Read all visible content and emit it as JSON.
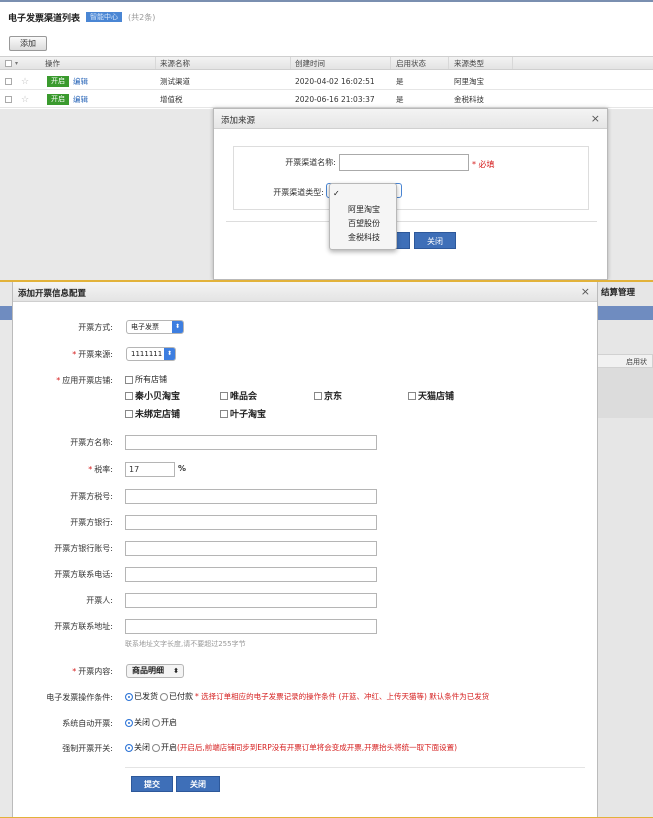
{
  "top_page": {
    "title": "电子发票渠道列表",
    "title_badge": "智能中心",
    "count": "(共2条)",
    "add_button": "添加",
    "columns": [
      "操作",
      "来源名称",
      "创建时间",
      "启用状态",
      "来源类型"
    ],
    "rows": [
      {
        "open": "开启",
        "edit": "编辑",
        "name": "测试渠道",
        "created": "2020-04-02 16:02:51",
        "enabled": "是",
        "type": "阿里淘宝"
      },
      {
        "open": "开启",
        "edit": "编辑",
        "name": "增值税",
        "created": "2020-06-16 21:03:37",
        "enabled": "是",
        "type": "金税科技"
      }
    ]
  },
  "source_dialog": {
    "title": "添加来源",
    "close_icon": "close-icon",
    "name_label": "开票渠道名称:",
    "name_value": "",
    "required_text": "* 必填",
    "type_label": "开票渠道类型:",
    "type_options": [
      "阿里淘宝",
      "百望股份",
      "金税科技"
    ],
    "close_button": "关闭"
  },
  "config_dialog": {
    "title": "添加开票信息配置",
    "close_icon": "close-icon",
    "method_label": "开票方式:",
    "method_value": "电子发票",
    "source_label": "开票来源:",
    "source_value": "1111111",
    "shops_label": "应用开票店铺:",
    "all_shops": "所有店铺",
    "shops_row1": [
      "秦小贝淘宝",
      "唯品会",
      "京东",
      "天猫店铺"
    ],
    "shops_row2": [
      "未绑定店铺",
      "叶子淘宝"
    ],
    "name_label": "开票方名称:",
    "rate_label": "税率:",
    "rate_value": "17",
    "rate_unit": "%",
    "taxno_label": "开票方税号:",
    "bank_label": "开票方银行:",
    "account_label": "开票方银行账号:",
    "phone_label": "开票方联系电话:",
    "drawer_label": "开票人:",
    "address_label": "开票方联系地址:",
    "address_hint": "联系地址文字长度,请不要超过255字节",
    "content_label": "开票内容:",
    "content_value": "商品明细",
    "condition_label": "电子发票操作条件:",
    "condition_paid": "已发货",
    "condition_paid2": "已付款",
    "condition_note": "* 选择订单相应的电子发票记录的操作条件 (开篮、冲红、上传天猫等) 默认条件为已发货",
    "auto_label": "系统自动开票:",
    "auto_off": "关闭",
    "auto_on": "开启",
    "force_label": "强制开票开关:",
    "force_off": "关闭",
    "force_on": "开启",
    "force_note": "(开启后,前端店铺同步到ERP没有开票订单将会变成开票,开票抬头将统一取下面设置)",
    "submit_button": "提交",
    "close_button": "关闭"
  },
  "background": {
    "right_title": "结算管理",
    "right_header": "启用状",
    "left_fragment": "开"
  },
  "colors": {
    "primary_button": "#3e6fb8",
    "open_button": "#3a9a2e",
    "required": "#d62020",
    "accent_border": "#e2b23a"
  }
}
